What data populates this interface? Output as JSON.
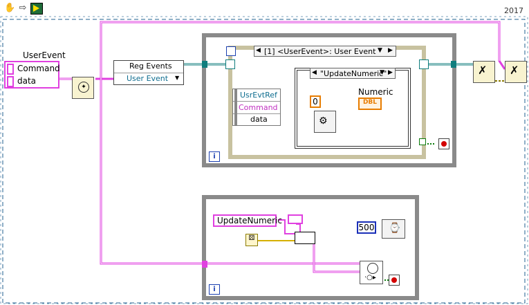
{
  "toolbar": {
    "run_icon": "hand-icon",
    "arrow_icon": "run-arrow-icon",
    "highlight_icon": "highlight-bulb-icon",
    "version": "2017"
  },
  "user_event_cluster": {
    "title": "UserEvent",
    "fields": [
      "Command",
      "data"
    ]
  },
  "register_events": {
    "title": "Reg Events",
    "item": "User Event"
  },
  "event_structure": {
    "selector": "[1] <UserEvent>: User Event",
    "fields": [
      "UsrEvtRef",
      "Command",
      "data"
    ]
  },
  "case_structure": {
    "selector": "\"UpdateNumeric\""
  },
  "numeric_indicator": {
    "label": "Numeric",
    "type": "DBL"
  },
  "constants": {
    "zero": "0",
    "update_string": "UpdateNumeric",
    "wait_ms": "500"
  },
  "loop_labels": {
    "top_iteration": "i",
    "bottom_iteration": "i"
  },
  "colors": {
    "wire_cluster": "#e040e0",
    "wire_ref": "#0f7d7d",
    "wire_numeric": "#1a2fb8",
    "wire_dbl": "#e77c00",
    "frame": "#8a8a8a",
    "stop": "#d30000"
  }
}
